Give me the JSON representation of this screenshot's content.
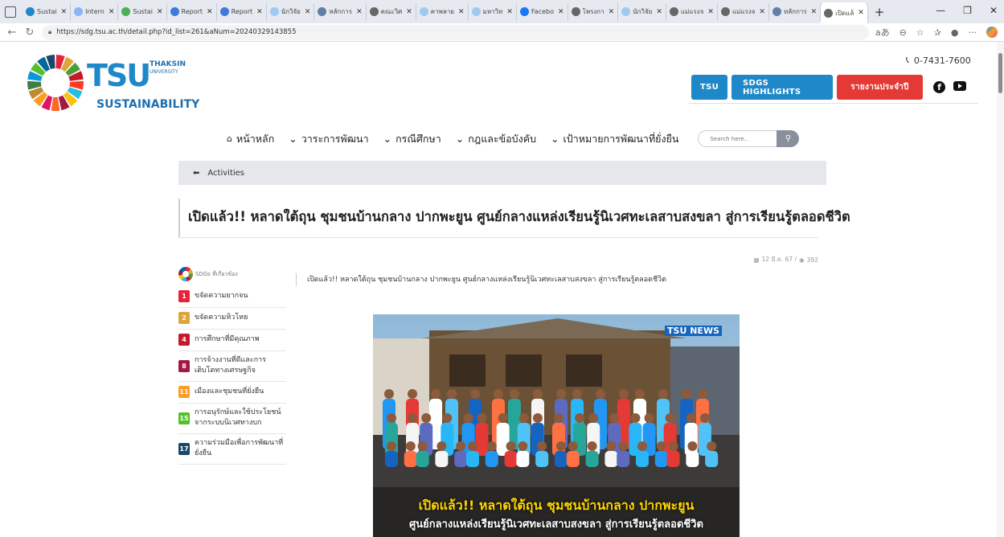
{
  "browser": {
    "tabs": [
      {
        "title": "Sustai",
        "color": "#1e88c8"
      },
      {
        "title": "Intern",
        "color": "#8ab4f8"
      },
      {
        "title": "Sustai",
        "color": "#4caf50"
      },
      {
        "title": "Report",
        "color": "#3d7bd9"
      },
      {
        "title": "Report",
        "color": "#3d7bd9"
      },
      {
        "title": "นักวิจัย",
        "color": "#9ecaf2"
      },
      {
        "title": "หลักการ",
        "color": "#5f7fa6"
      },
      {
        "title": "คณะวิศ",
        "color": "#666666"
      },
      {
        "title": "คาพลาย",
        "color": "#9ecaf2"
      },
      {
        "title": "มหาวิท",
        "color": "#9ecaf2"
      },
      {
        "title": "Facebo",
        "color": "#1877f2"
      },
      {
        "title": "โพรงกา",
        "color": "#666666"
      },
      {
        "title": "นักวิจัย",
        "color": "#9ecaf2"
      },
      {
        "title": "แม่แรงจ",
        "color": "#666666"
      },
      {
        "title": "แม่แรงจ",
        "color": "#666666"
      },
      {
        "title": "หลักการ",
        "color": "#5f7fa6"
      },
      {
        "title": "เปิดแล้",
        "color": "#666666"
      }
    ],
    "url": "https://sdg.tsu.ac.th/detail.php?id_list=261&aNum=20240329143855"
  },
  "brand": {
    "tsu": "TSU",
    "thaksin": "THAKSIN",
    "university": "UNIVERSITY",
    "sustainability": "SUSTAINABILITY"
  },
  "header": {
    "phone": "0-7431-7600",
    "buttons": {
      "tsu": "TSU",
      "highlights": "SDGS HIGHLIGHTS",
      "report": "รายงานประจำปี"
    }
  },
  "nav": {
    "home": "หน้าหลัก",
    "items": [
      "วาระการพัฒนา",
      "กรณีศึกษา",
      "กฎและข้อบังคับ",
      "เป้าหมายการพัฒนาที่ยั่งยืน"
    ],
    "search_placeholder": "Search here.."
  },
  "breadcrumb": {
    "label": "Activities"
  },
  "article": {
    "title": "เปิดแล้ว!! หลาดใต้ถุน ชุมชนบ้านกลาง ปากพะยูน ศูนย์กลางแหล่งเรียนรู้นิเวศทะเลสาบสงขลา สู่การเรียนรู้ตลอดชีวิต",
    "date": "12 มี.ค. 67 /",
    "views": "392",
    "body": "เปิดแล้ว!! หลาดใต้ถุน ชุมชนบ้านกลาง ปากพะยูน ศูนย์กลางแหล่งเรียนรู้นิเวศทะเลสาบสงขลา สู่การเรียนรู้ตลอดชีวิต",
    "image": {
      "badge": "TSU NEWS",
      "caption_line1": "เปิดแล้ว!! หลาดใต้ถุน ชุมชนบ้านกลาง ปากพะยูน",
      "caption_line2": "ศูนย์กลางแหล่งเรียนรู้นิเวศทะเลสาบสงขลา สู่การเรียนรู้ตลอดชีวิต"
    }
  },
  "sdgs": {
    "heading": "SDGs ที่เกี่ยวข้อง",
    "items": [
      {
        "num": "1",
        "label": "ขจัดความยากจน",
        "color": "#e5243b"
      },
      {
        "num": "2",
        "label": "ขจัดความหิวโหย",
        "color": "#dda63a"
      },
      {
        "num": "4",
        "label": "การศึกษาที่มีคุณภาพ",
        "color": "#c5192d"
      },
      {
        "num": "8",
        "label": "การจ้างงานที่ดีและการเติบโตทางเศรษฐกิจ",
        "color": "#a21942"
      },
      {
        "num": "11",
        "label": "เมืองและชุมชนที่ยั่งยืน",
        "color": "#fd9d24"
      },
      {
        "num": "15",
        "label": "การอนุรักษ์และใช้ประโยชน์จากระบบนิเวศทางบก",
        "color": "#56c02b"
      },
      {
        "num": "17",
        "label": "ความร่วมมือเพื่อการพัฒนาที่ยั่งยืน",
        "color": "#19486a"
      }
    ]
  }
}
